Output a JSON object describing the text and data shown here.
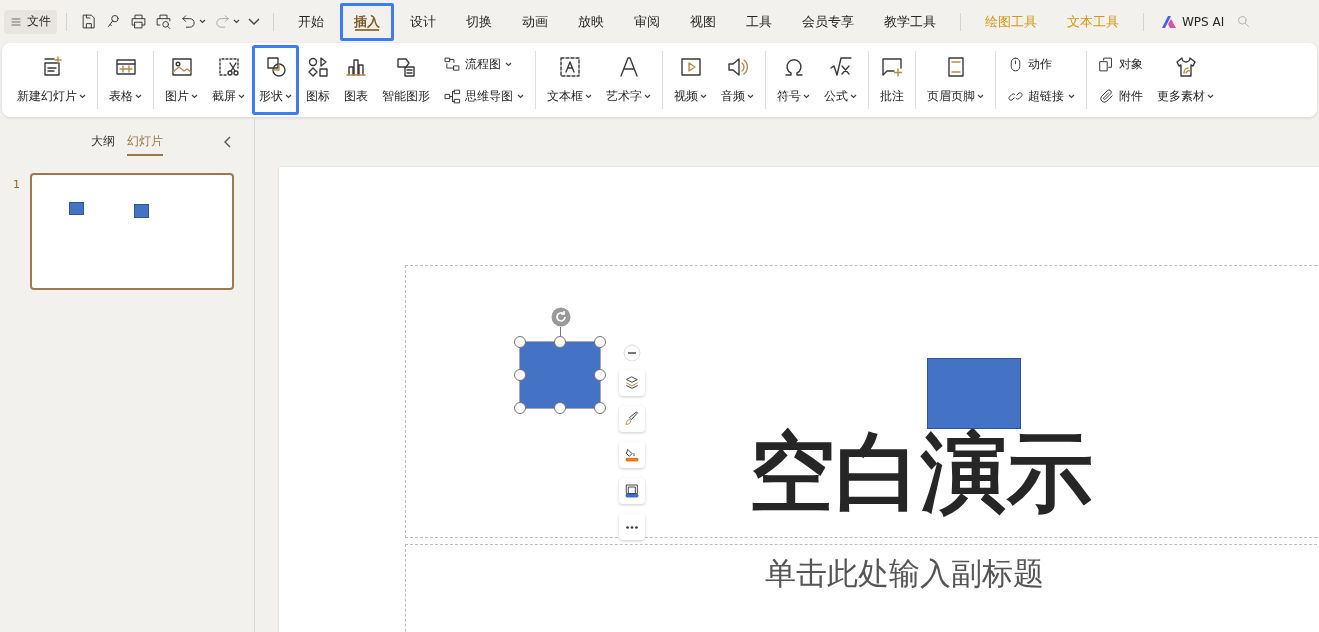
{
  "file_menu": {
    "label": "文件"
  },
  "tabs": [
    {
      "label": "开始",
      "selected": false,
      "kind": "normal",
      "highlighted": false
    },
    {
      "label": "插入",
      "selected": true,
      "kind": "normal",
      "highlighted": true
    },
    {
      "label": "设计",
      "selected": false,
      "kind": "normal",
      "highlighted": false
    },
    {
      "label": "切换",
      "selected": false,
      "kind": "normal",
      "highlighted": false
    },
    {
      "label": "动画",
      "selected": false,
      "kind": "normal",
      "highlighted": false
    },
    {
      "label": "放映",
      "selected": false,
      "kind": "normal",
      "highlighted": false
    },
    {
      "label": "审阅",
      "selected": false,
      "kind": "normal",
      "highlighted": false
    },
    {
      "label": "视图",
      "selected": false,
      "kind": "normal",
      "highlighted": false
    },
    {
      "label": "工具",
      "selected": false,
      "kind": "normal",
      "highlighted": false
    },
    {
      "label": "会员专享",
      "selected": false,
      "kind": "normal",
      "highlighted": false
    },
    {
      "label": "教学工具",
      "selected": false,
      "kind": "normal",
      "highlighted": false
    },
    {
      "label": "绘图工具",
      "selected": false,
      "kind": "context",
      "highlighted": false
    },
    {
      "label": "文本工具",
      "selected": false,
      "kind": "context",
      "highlighted": false
    }
  ],
  "ai_button": {
    "label": "WPS AI"
  },
  "ribbon_groups": [
    {
      "items": [
        {
          "label": "新建幻灯片",
          "kind": "large",
          "dropdown": true,
          "highlighted": false
        }
      ]
    },
    {
      "items": [
        {
          "label": "表格",
          "kind": "large",
          "dropdown": true,
          "highlighted": false
        }
      ]
    },
    {
      "items": [
        {
          "label": "图片",
          "kind": "large",
          "dropdown": true,
          "highlighted": false
        },
        {
          "label": "截屏",
          "kind": "large",
          "dropdown": true,
          "highlighted": false
        },
        {
          "label": "形状",
          "kind": "large",
          "dropdown": true,
          "highlighted": true
        },
        {
          "label": "图标",
          "kind": "large",
          "dropdown": false,
          "highlighted": false
        },
        {
          "label": "图表",
          "kind": "large",
          "dropdown": false,
          "highlighted": false
        },
        {
          "label": "智能图形",
          "kind": "large",
          "dropdown": false,
          "highlighted": false
        },
        {
          "label": "流程图",
          "kind": "small",
          "dropdown": true,
          "highlighted": false
        },
        {
          "label": "思维导图",
          "kind": "small",
          "dropdown": true,
          "highlighted": false
        }
      ]
    },
    {
      "items": [
        {
          "label": "文本框",
          "kind": "large",
          "dropdown": true,
          "highlighted": false
        },
        {
          "label": "艺术字",
          "kind": "large",
          "dropdown": true,
          "highlighted": false
        }
      ]
    },
    {
      "items": [
        {
          "label": "视频",
          "kind": "large",
          "dropdown": true,
          "highlighted": false
        },
        {
          "label": "音频",
          "kind": "large",
          "dropdown": true,
          "highlighted": false
        }
      ]
    },
    {
      "items": [
        {
          "label": "符号",
          "kind": "large",
          "dropdown": true,
          "highlighted": false
        },
        {
          "label": "公式",
          "kind": "large",
          "dropdown": true,
          "highlighted": false
        }
      ]
    },
    {
      "items": [
        {
          "label": "批注",
          "kind": "large",
          "dropdown": false,
          "highlighted": false
        }
      ]
    },
    {
      "items": [
        {
          "label": "页眉页脚",
          "kind": "large",
          "dropdown": true,
          "highlighted": false
        }
      ]
    },
    {
      "items": [
        {
          "label": "动作",
          "kind": "small",
          "dropdown": false,
          "highlighted": false
        },
        {
          "label": "超链接",
          "kind": "small",
          "dropdown": true,
          "highlighted": false
        }
      ]
    },
    {
      "items": [
        {
          "label": "对象",
          "kind": "small",
          "dropdown": false,
          "highlighted": false
        },
        {
          "label": "附件",
          "kind": "small",
          "dropdown": false,
          "highlighted": false
        },
        {
          "label": "更多素材",
          "kind": "large",
          "dropdown": true,
          "highlighted": false
        }
      ]
    }
  ],
  "side_panel": {
    "tabs": [
      {
        "label": "大纲",
        "selected": false
      },
      {
        "label": "幻灯片",
        "selected": true
      }
    ],
    "slides": [
      {
        "number": "1",
        "selected": true
      }
    ]
  },
  "slide": {
    "title": "空白演示",
    "subtitle_placeholder": "单击此处输入副标题",
    "shapes": [
      {
        "selected": true
      },
      {
        "selected": false
      }
    ]
  }
}
